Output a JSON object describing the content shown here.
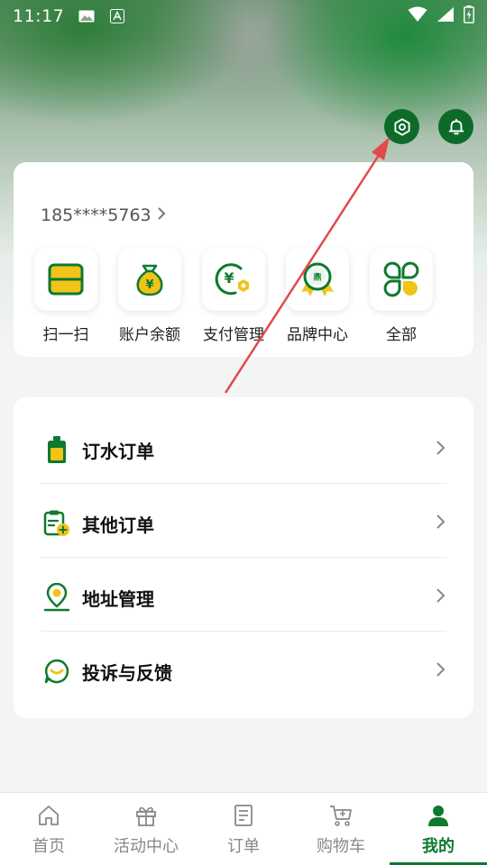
{
  "status_bar": {
    "time": "11:17"
  },
  "profile": {
    "phone": "185****5763"
  },
  "quick_actions": [
    {
      "label": "扫一扫",
      "icon": "scan-icon"
    },
    {
      "label": "账户余额",
      "icon": "money-bag-icon"
    },
    {
      "label": "支付管理",
      "icon": "payment-settings-icon"
    },
    {
      "label": "品牌中心",
      "icon": "brand-badge-icon"
    },
    {
      "label": "全部",
      "icon": "clover-icon"
    }
  ],
  "menu": [
    {
      "label": "订水订单",
      "icon": "water-bottle-icon"
    },
    {
      "label": "其他订单",
      "icon": "clipboard-add-icon"
    },
    {
      "label": "地址管理",
      "icon": "location-pin-icon"
    },
    {
      "label": "投诉与反馈",
      "icon": "chat-smile-icon"
    }
  ],
  "tabs": [
    {
      "label": "首页",
      "icon": "home-icon"
    },
    {
      "label": "活动中心",
      "icon": "gift-icon"
    },
    {
      "label": "订单",
      "icon": "list-icon"
    },
    {
      "label": "购物车",
      "icon": "cart-icon"
    },
    {
      "label": "我的",
      "icon": "user-icon"
    }
  ],
  "active_tab": "我的",
  "colors": {
    "brand_green": "#0d7a2f",
    "accent_yellow": "#f2c318",
    "arrow_red": "#e24a4a"
  }
}
